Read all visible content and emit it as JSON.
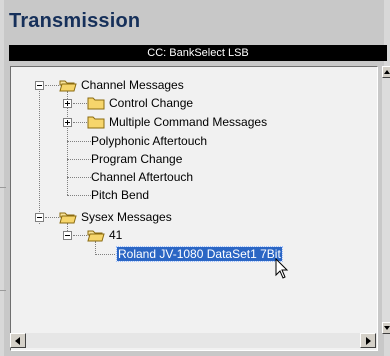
{
  "window": {
    "title": "Transmission",
    "header_bar": "CC: BankSelect LSB"
  },
  "tree": {
    "channel_messages": {
      "label": "Channel Messages",
      "children": {
        "control_change": "Control Change",
        "multiple_command": "Multiple Command Messages",
        "poly_aftertouch": "Polyphonic Aftertouch",
        "program_change": "Program Change",
        "channel_aftertouch": "Channel Aftertouch",
        "pitch_bend": "Pitch Bend"
      }
    },
    "sysex_messages": {
      "label": "Sysex Messages",
      "folder_41": "41",
      "selected_item": "Roland JV-1080 DataSet1 7Bit"
    }
  },
  "colors": {
    "title": "#16305a",
    "header_bg": "#000000",
    "selection": "#2b66c4",
    "folder": "#f6d56b"
  }
}
